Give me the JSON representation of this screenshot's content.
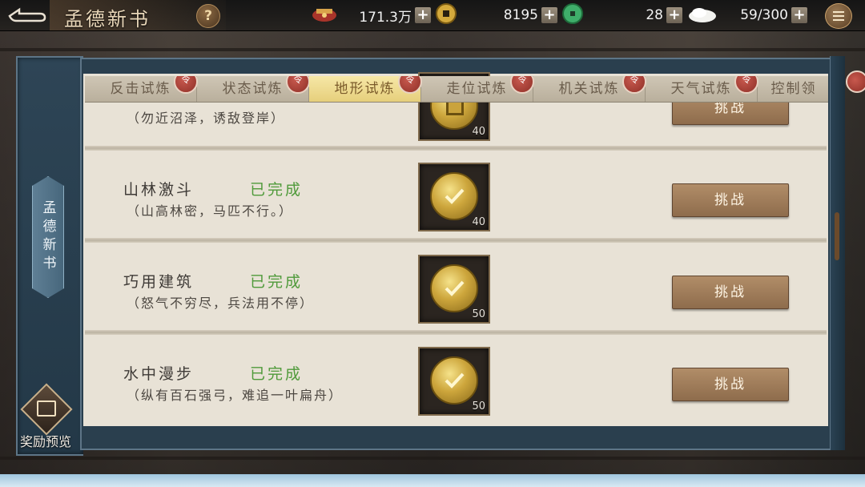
{
  "header": {
    "title": "孟德新书",
    "help_label": "?",
    "resources": [
      {
        "icon": "treasure-pouch-icon",
        "value": "171.3万"
      },
      {
        "icon": "copper-coin-icon",
        "value": "8195"
      },
      {
        "icon": "jade-icon",
        "value": "28"
      },
      {
        "icon": "bun-stamina-icon",
        "value": "59/300"
      }
    ]
  },
  "sidebar": {
    "tab_label": "孟德新书",
    "reward_preview_label": "奖励预览"
  },
  "tabs": [
    {
      "label": "反击试炼",
      "active": false,
      "badge": "令"
    },
    {
      "label": "状态试炼",
      "active": false,
      "badge": "令"
    },
    {
      "label": "地形试炼",
      "active": true,
      "badge": "令"
    },
    {
      "label": "走位试炼",
      "active": false,
      "badge": "令"
    },
    {
      "label": "机关试炼",
      "active": false,
      "badge": "令"
    },
    {
      "label": "天气试炼",
      "active": false,
      "badge": "令"
    },
    {
      "label": "控制领",
      "active": false,
      "badge": ""
    }
  ],
  "rows": [
    {
      "title": "",
      "status": "",
      "desc": "（勿近沼泽，诱敌登岸）",
      "reward_count": "40",
      "button": "挑战"
    },
    {
      "title": "山林激斗",
      "status": "已完成",
      "desc": "（山高林密，马匹不行。）",
      "reward_count": "40",
      "button": "挑战"
    },
    {
      "title": "巧用建筑",
      "status": "已完成",
      "desc": "（怒气不穷尽，兵法用不停）",
      "reward_count": "50",
      "button": "挑战"
    },
    {
      "title": "水中漫步",
      "status": "已完成",
      "desc": "（纵有百石强弓，难追一叶扁舟）",
      "reward_count": "50",
      "button": "挑战"
    }
  ]
}
